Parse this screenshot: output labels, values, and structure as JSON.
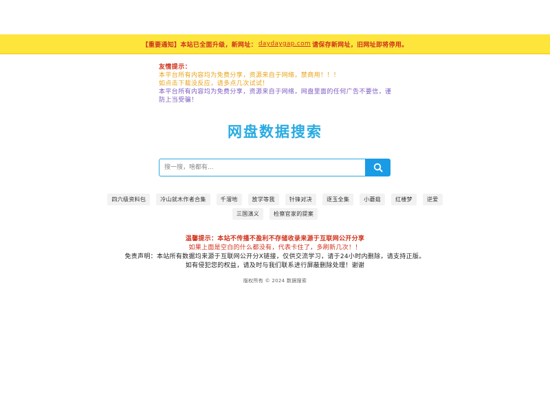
{
  "notice": {
    "prefix": "【重要通知】本站已全面升级，新网址：",
    "url": "daydaygap.com",
    "suffix": " 请保存新网址，旧网址即将停用。"
  },
  "tips": {
    "title": "友情提示：",
    "line1": "本平台所有内容均为免费分享，资源来自于网络，禁商用！！！",
    "line2": "如点击下载没反应，请多点几次试试！",
    "line3": "本平台所有内容均为免费分享，资源来自于网络，网盘里面的任何广告不要信，谨防上当受骗！"
  },
  "site_title": "网盘数据搜索",
  "search": {
    "placeholder": "搜一搜，啥都有...",
    "button_icon": "search-icon"
  },
  "tags": [
    "四六级资料包",
    "冷山就木作者合集",
    "千溜地",
    "放学等我",
    "针锋对决",
    "逐玉全集",
    "小蘑菇",
    "红楼梦",
    "逆爱",
    "三国演义",
    "检察官家的提案"
  ],
  "warm": {
    "line1": "温馨提示：本站不传播不盈利不存储收录来源于互联网公开分享",
    "line2": "如果上面是空白的什么都没有，代表卡住了，多刷新几次！！",
    "line3": "免责声明：本站所有数据均来源于互联网公开分X链接，仅供交流学习，请于24小时内删除，请支持正版。",
    "line4": "如有侵犯您的权益，请及时与我们联系进行屏蔽删除处理！谢谢"
  },
  "copyright": "版权所有 © 2024 数据搜索",
  "colors": {
    "notice_bg": "#fde53b",
    "accent": "#29abe2",
    "button": "#1a9be6",
    "warning": "#d0321b"
  }
}
